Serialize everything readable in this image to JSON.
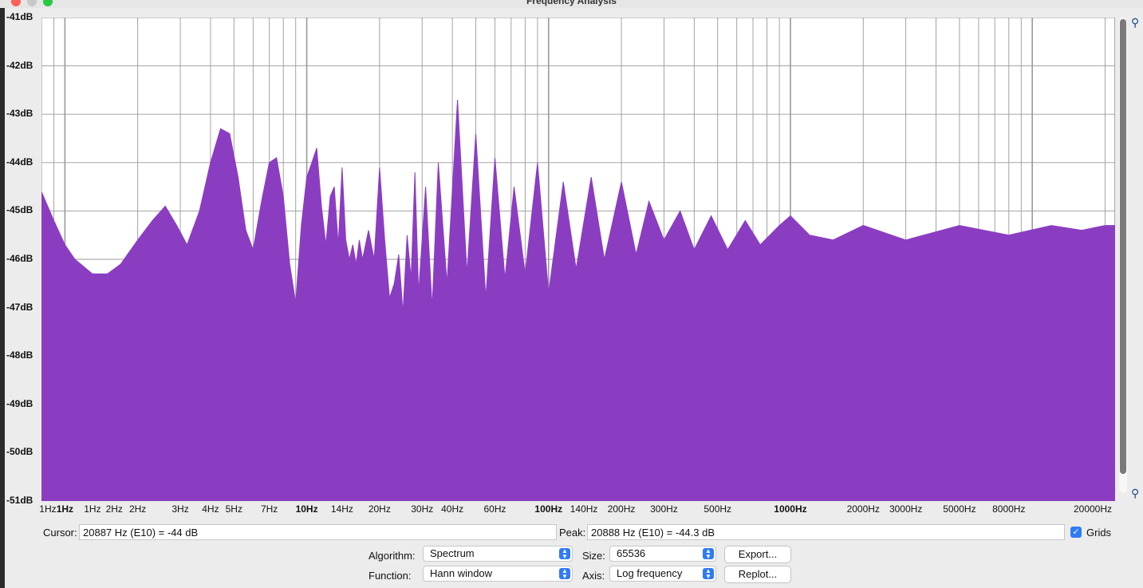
{
  "window": {
    "title": "Frequency Analysis"
  },
  "colors": {
    "spectrum_fill": "#8b3dc2",
    "grid": "#9a9a9a",
    "accent": "#2f7bf5"
  },
  "icons": {
    "zoom_in": "zoom-in-icon",
    "zoom_out": "zoom-out-icon",
    "dropdown": "chevron-updown-icon",
    "checkbox": "checkmark-icon"
  },
  "chart_data": {
    "type": "area",
    "xscale": "log",
    "xlim": [
      0.8,
      22000
    ],
    "ylim": [
      -51,
      -41
    ],
    "grid": true,
    "y_ticks": [
      "-41dB",
      "-42dB",
      "-43dB",
      "-44dB",
      "-45dB",
      "-46dB",
      "-47dB",
      "-48dB",
      "-49dB",
      "-50dB",
      "-51dB"
    ],
    "x_ticks": [
      {
        "label": "1Hz",
        "value": 0.85,
        "bold": false
      },
      {
        "label": "1Hz",
        "value": 1,
        "bold": true
      },
      {
        "label": "1Hz",
        "value": 1.3,
        "bold": false
      },
      {
        "label": "2Hz",
        "value": 1.6,
        "bold": false
      },
      {
        "label": "2Hz",
        "value": 2,
        "bold": false
      },
      {
        "label": "3Hz",
        "value": 3,
        "bold": false
      },
      {
        "label": "4Hz",
        "value": 4,
        "bold": false
      },
      {
        "label": "5Hz",
        "value": 5,
        "bold": false
      },
      {
        "label": "7Hz",
        "value": 7,
        "bold": false
      },
      {
        "label": "10Hz",
        "value": 10,
        "bold": true
      },
      {
        "label": "14Hz",
        "value": 14,
        "bold": false
      },
      {
        "label": "20Hz",
        "value": 20,
        "bold": false
      },
      {
        "label": "30Hz",
        "value": 30,
        "bold": false
      },
      {
        "label": "40Hz",
        "value": 40,
        "bold": false
      },
      {
        "label": "60Hz",
        "value": 60,
        "bold": false
      },
      {
        "label": "100Hz",
        "value": 100,
        "bold": true
      },
      {
        "label": "140Hz",
        "value": 140,
        "bold": false
      },
      {
        "label": "200Hz",
        "value": 200,
        "bold": false
      },
      {
        "label": "300Hz",
        "value": 300,
        "bold": false
      },
      {
        "label": "500Hz",
        "value": 500,
        "bold": false
      },
      {
        "label": "1000Hz",
        "value": 1000,
        "bold": true
      },
      {
        "label": "2000Hz",
        "value": 2000,
        "bold": false
      },
      {
        "label": "3000Hz",
        "value": 3000,
        "bold": false
      },
      {
        "label": "5000Hz",
        "value": 5000,
        "bold": false
      },
      {
        "label": "8000Hz",
        "value": 8000,
        "bold": false
      },
      {
        "label": "20000Hz",
        "value": 20000,
        "bold": false
      }
    ],
    "series": [
      {
        "x": [
          0.8,
          0.9,
          1.0,
          1.1,
          1.3,
          1.5,
          1.7,
          2.0,
          2.3,
          2.6,
          2.9,
          3.2,
          3.6,
          4.0,
          4.4,
          4.8,
          5.2,
          5.6,
          6.0,
          6.5,
          7.0,
          7.5,
          8.0,
          8.5,
          9.0,
          9.5,
          10.0,
          10.5,
          11.0,
          11.5,
          12.0,
          12.5,
          13.0,
          13.5,
          14.0,
          14.5,
          15.0,
          15.5,
          16.0,
          16.5,
          17.0,
          18.0,
          19.0,
          20.0,
          21.0,
          22.0,
          23.0,
          24.0,
          25.0,
          26.0,
          27.0,
          28.0,
          29.0,
          31.0,
          33.0,
          35.0,
          38.0,
          42.0,
          46.0,
          50.0,
          55.0,
          60.0,
          66.0,
          72.0,
          80.0,
          90.0,
          100.0,
          115.0,
          130.0,
          150.0,
          170.0,
          200.0,
          230.0,
          260.0,
          300.0,
          350.0,
          400.0,
          470.0,
          550.0,
          650.0,
          750.0,
          900.0,
          1000.0,
          1200.0,
          1500.0,
          2000.0,
          3000.0,
          5000.0,
          8000.0,
          12000.0,
          16000.0,
          20000.0,
          22000.0
        ],
        "y": [
          -44.6,
          -45.2,
          -45.7,
          -46.0,
          -46.3,
          -46.3,
          -46.1,
          -45.6,
          -45.2,
          -44.9,
          -45.3,
          -45.7,
          -45.0,
          -44.0,
          -43.3,
          -43.4,
          -44.3,
          -45.4,
          -45.8,
          -44.8,
          -44.0,
          -43.9,
          -44.7,
          -46.1,
          -46.9,
          -45.3,
          -44.3,
          -44.0,
          -43.7,
          -44.9,
          -45.7,
          -44.7,
          -44.5,
          -45.7,
          -44.1,
          -45.6,
          -46.0,
          -45.7,
          -46.1,
          -45.6,
          -46.0,
          -45.4,
          -46.0,
          -44.1,
          -45.6,
          -46.8,
          -46.5,
          -45.9,
          -47.1,
          -45.5,
          -46.4,
          -44.2,
          -46.7,
          -44.5,
          -47.0,
          -44.0,
          -46.5,
          -42.7,
          -46.3,
          -43.4,
          -46.8,
          -43.9,
          -46.4,
          -44.5,
          -46.3,
          -44.0,
          -46.7,
          -44.4,
          -46.2,
          -44.3,
          -46.0,
          -44.4,
          -45.9,
          -44.8,
          -45.6,
          -45.0,
          -45.8,
          -45.1,
          -45.8,
          -45.2,
          -45.7,
          -45.3,
          -45.1,
          -45.5,
          -45.6,
          -45.3,
          -45.6,
          -45.3,
          -45.5,
          -45.3,
          -45.4,
          -45.3,
          -45.3
        ]
      }
    ]
  },
  "footer": {
    "cursor_label": "Cursor:",
    "cursor_value": "20887 Hz (E10) = -44 dB",
    "peak_label": "Peak:",
    "peak_value": "20888 Hz (E10) = -44.3 dB",
    "grids_label": "Grids",
    "grids_checked": true,
    "algorithm_label": "Algorithm:",
    "algorithm_value": "Spectrum",
    "size_label": "Size:",
    "size_value": "65536",
    "function_label": "Function:",
    "function_value": "Hann window",
    "axis_label": "Axis:",
    "axis_value": "Log frequency",
    "export_label": "Export...",
    "replot_label": "Replot..."
  }
}
